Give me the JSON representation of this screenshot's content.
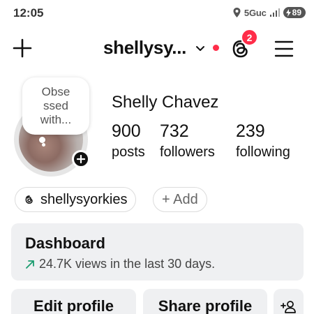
{
  "status_bar": {
    "time": "12:05",
    "network": "5Guc",
    "battery": "89"
  },
  "header": {
    "username": "shellysy...",
    "notification_count": "2"
  },
  "profile": {
    "note": "Obse ssed with...",
    "full_name": "Shelly Chavez",
    "stats": [
      {
        "count": "900",
        "label": "posts"
      },
      {
        "count": "732",
        "label": "followers"
      },
      {
        "count": "239",
        "label": "following"
      }
    ],
    "threads_handle": "shellysyorkies",
    "add_label": "+ Add"
  },
  "dashboard": {
    "title": "Dashboard",
    "subtitle": "24.7K views in the last 30 days.",
    "trend_color": "#1a9c6e"
  },
  "actions": {
    "edit_profile": "Edit profile",
    "share_profile": "Share profile"
  },
  "icons": {
    "create": "plus-icon",
    "chevron": "chevron-down-icon",
    "threads": "threads-icon",
    "menu": "hamburger-menu-icon",
    "add_person": "add-person-icon",
    "trend": "trend-up-icon"
  },
  "colors": {
    "accent_red": "#ff2d49"
  }
}
